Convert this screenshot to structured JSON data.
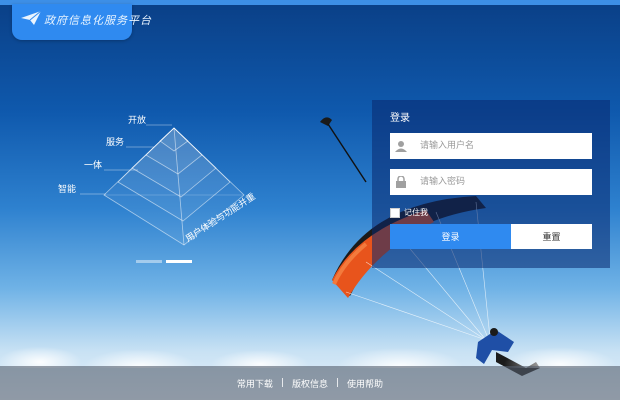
{
  "header": {
    "logo_text": "政府信息化服务平台"
  },
  "showcase": {
    "pyramid_levels": [
      "开放",
      "服务",
      "一体",
      "智能"
    ],
    "pyramid_base_caption": "用户体验与功能并重",
    "slider_active_index": 2,
    "slider_total": 2
  },
  "login": {
    "title": "登录",
    "username_placeholder": "请输入用户名",
    "password_placeholder": "请输入密码",
    "remember_label": "记住我",
    "login_button": "登录",
    "reset_button": "重置"
  },
  "footer": {
    "links": [
      "常用下载",
      "版权信息",
      "使用帮助"
    ],
    "separator": "|"
  },
  "colors": {
    "accent": "#2f8af0",
    "sky_top": "#0a3f86",
    "sky_bottom": "#e8f2fa",
    "parachute_orange": "#e8541c"
  }
}
